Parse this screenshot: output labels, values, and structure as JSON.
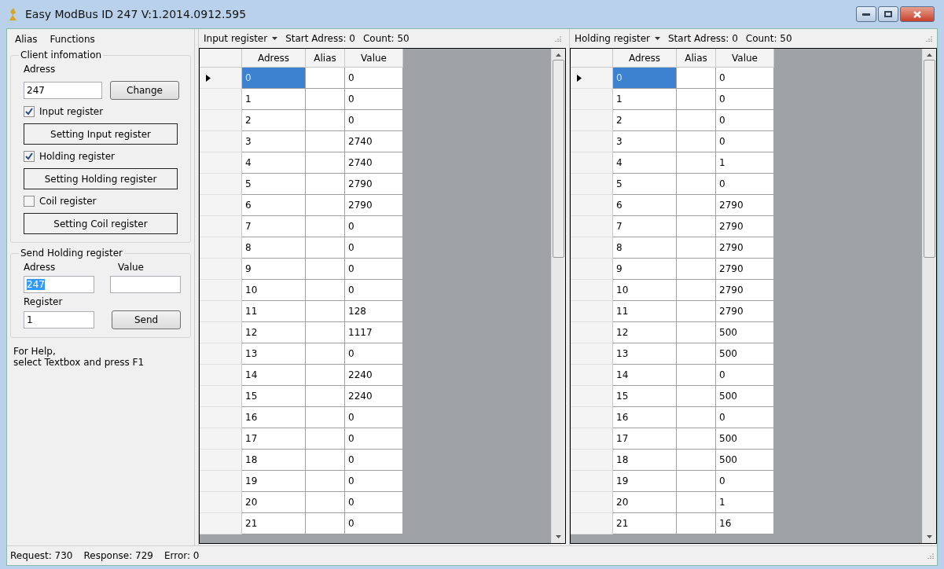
{
  "window": {
    "title": "Easy ModBus ID 247 V:1.2014.0912.595"
  },
  "menu": [
    "Alias",
    "Functions"
  ],
  "client_info": {
    "title": "Client infomation",
    "address_label": "Adress",
    "address_value": "247",
    "change_button": "Change",
    "items": [
      {
        "kind": "checkbox",
        "label": "Input register",
        "checked": true
      },
      {
        "kind": "button",
        "label": "Setting Input register"
      },
      {
        "kind": "checkbox",
        "label": "Holding register",
        "checked": true
      },
      {
        "kind": "button",
        "label": "Setting Holding register"
      },
      {
        "kind": "checkbox",
        "label": "Coil register",
        "checked": false
      },
      {
        "kind": "button",
        "label": "Setting Coil register"
      }
    ]
  },
  "send_holding": {
    "title": "Send Holding register",
    "address_label": "Adress",
    "address_value": "247",
    "address_text_selected": true,
    "value_label": "Value",
    "register_label": "Register",
    "register_value": "1",
    "send_button": "Send",
    "help": "For Help,\nselect Textbox and press F1"
  },
  "grids": [
    {
      "register_type": "Input register",
      "start": "Start Adress: 0",
      "count": "Count: 50",
      "columns": [
        "Adress",
        "Alias",
        "Value"
      ],
      "rows": [
        {
          "adress": "0",
          "value": "0",
          "selected": true
        },
        {
          "adress": "1",
          "value": "0",
          "selected": false
        },
        {
          "adress": "2",
          "value": "0",
          "selected": false
        },
        {
          "adress": "3",
          "value": "2740",
          "selected": false
        },
        {
          "adress": "4",
          "value": "2740",
          "selected": false
        },
        {
          "adress": "5",
          "value": "2790",
          "selected": false
        },
        {
          "adress": "6",
          "value": "2790",
          "selected": false
        },
        {
          "adress": "7",
          "value": "0",
          "selected": false
        },
        {
          "adress": "8",
          "value": "0",
          "selected": false
        },
        {
          "adress": "9",
          "value": "0",
          "selected": false
        },
        {
          "adress": "10",
          "value": "0",
          "selected": false
        },
        {
          "adress": "11",
          "value": "128",
          "selected": false
        },
        {
          "adress": "12",
          "value": "1117",
          "selected": false
        },
        {
          "adress": "13",
          "value": "0",
          "selected": false
        },
        {
          "adress": "14",
          "value": "2240",
          "selected": false
        },
        {
          "adress": "15",
          "value": "2240",
          "selected": false
        },
        {
          "adress": "16",
          "value": "0",
          "selected": false
        },
        {
          "adress": "17",
          "value": "0",
          "selected": false
        },
        {
          "adress": "18",
          "value": "0",
          "selected": false
        },
        {
          "adress": "19",
          "value": "0",
          "selected": false
        },
        {
          "adress": "20",
          "value": "0",
          "selected": false
        },
        {
          "adress": "21",
          "value": "0",
          "selected": false
        }
      ]
    },
    {
      "register_type": "Holding register",
      "start": "Start Adress: 0",
      "count": "Count: 50",
      "columns": [
        "Adress",
        "Alias",
        "Value"
      ],
      "rows": [
        {
          "adress": "0",
          "value": "0",
          "selected": true
        },
        {
          "adress": "1",
          "value": "0",
          "selected": false
        },
        {
          "adress": "2",
          "value": "0",
          "selected": false
        },
        {
          "adress": "3",
          "value": "0",
          "selected": false
        },
        {
          "adress": "4",
          "value": "1",
          "selected": false
        },
        {
          "adress": "5",
          "value": "0",
          "selected": false
        },
        {
          "adress": "6",
          "value": "2790",
          "selected": false
        },
        {
          "adress": "7",
          "value": "2790",
          "selected": false
        },
        {
          "adress": "8",
          "value": "2790",
          "selected": false
        },
        {
          "adress": "9",
          "value": "2790",
          "selected": false
        },
        {
          "adress": "10",
          "value": "2790",
          "selected": false
        },
        {
          "adress": "11",
          "value": "2790",
          "selected": false
        },
        {
          "adress": "12",
          "value": "500",
          "selected": false
        },
        {
          "adress": "13",
          "value": "500",
          "selected": false
        },
        {
          "adress": "14",
          "value": "0",
          "selected": false
        },
        {
          "adress": "15",
          "value": "500",
          "selected": false
        },
        {
          "adress": "16",
          "value": "0",
          "selected": false
        },
        {
          "adress": "17",
          "value": "500",
          "selected": false
        },
        {
          "adress": "18",
          "value": "500",
          "selected": false
        },
        {
          "adress": "19",
          "value": "0",
          "selected": false
        },
        {
          "adress": "20",
          "value": "1",
          "selected": false
        },
        {
          "adress": "21",
          "value": "16",
          "selected": false
        }
      ]
    }
  ],
  "status_bar": [
    "Request: 730",
    "Response: 729",
    "Error: 0"
  ]
}
